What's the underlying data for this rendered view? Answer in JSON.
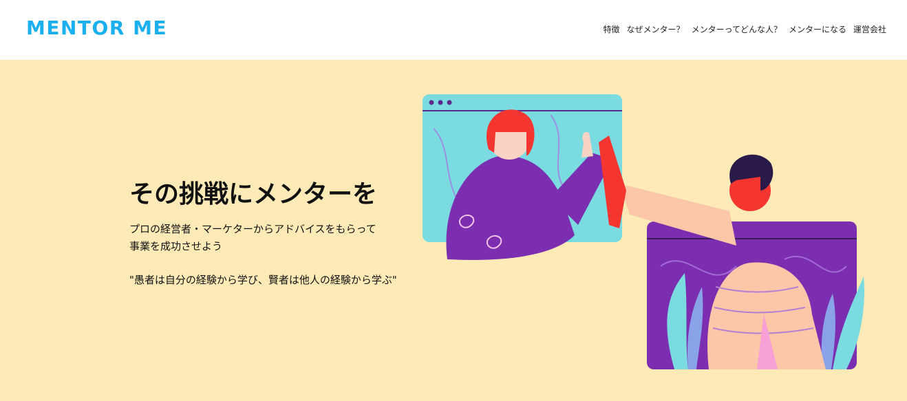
{
  "header": {
    "logo": "MENTOR ME",
    "nav": [
      {
        "label": "特徴"
      },
      {
        "label": "なぜメンター？"
      },
      {
        "label": "メンターってどんな人？"
      },
      {
        "label": "メンターになる"
      },
      {
        "label": "運営会社"
      }
    ]
  },
  "hero": {
    "headline": "その挑戦にメンターを",
    "sub_line1": "プロの経営者・マーケターからアドバイスをもらって",
    "sub_line2": "事業を成功させよう",
    "quote": "\"愚者は自分の経験から学び、賢者は他人の経験から学ぶ\""
  },
  "colors": {
    "brand": "#1ab0f0",
    "hero_bg": "#fdeab6",
    "window_teal": "#7adbe0",
    "window_purple": "#7b2fb0",
    "hair_red": "#f5352f"
  }
}
